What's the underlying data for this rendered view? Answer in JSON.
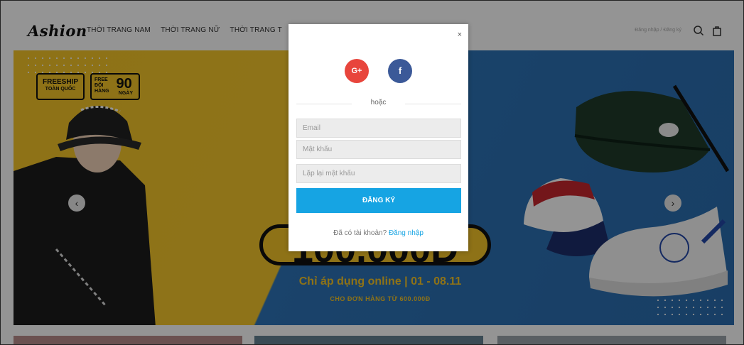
{
  "header": {
    "logo": "Ashion",
    "nav": [
      "THỜI TRANG NAM",
      "THỜI TRANG NỮ",
      "THỜI TRANG T"
    ],
    "auth_link": "Đăng nhập / Đăng ký"
  },
  "banner": {
    "badge_freeship": "FREESHIP",
    "badge_freeship_sub": "TOÀN QUỐC",
    "badge_free": "FREE ĐỔI HÀNG",
    "badge_days": "90",
    "badge_days_sub": "NGÀY",
    "price": "100.000Đ",
    "promo_line": "Chỉ áp dụng online | 01 - 08.11",
    "promo_sub": "CHO ĐƠN HÀNG TỪ 600.000Đ"
  },
  "modal": {
    "close": "×",
    "gplus": "G+",
    "facebook": "f",
    "or": "hoặc",
    "email_placeholder": "Email",
    "password_placeholder": "Mật khẩu",
    "repeat_placeholder": "Lặp lại mật khẩu",
    "submit": "ĐĂNG KÝ",
    "have_account": "Đã có tài khoản?",
    "login_link": "Đăng nhập"
  },
  "colors": {
    "accent": "#16a4e3",
    "gplus": "#e8453c",
    "facebook": "#3b5998",
    "banner_yellow": "#f4c528",
    "banner_blue": "#2d74b8"
  }
}
